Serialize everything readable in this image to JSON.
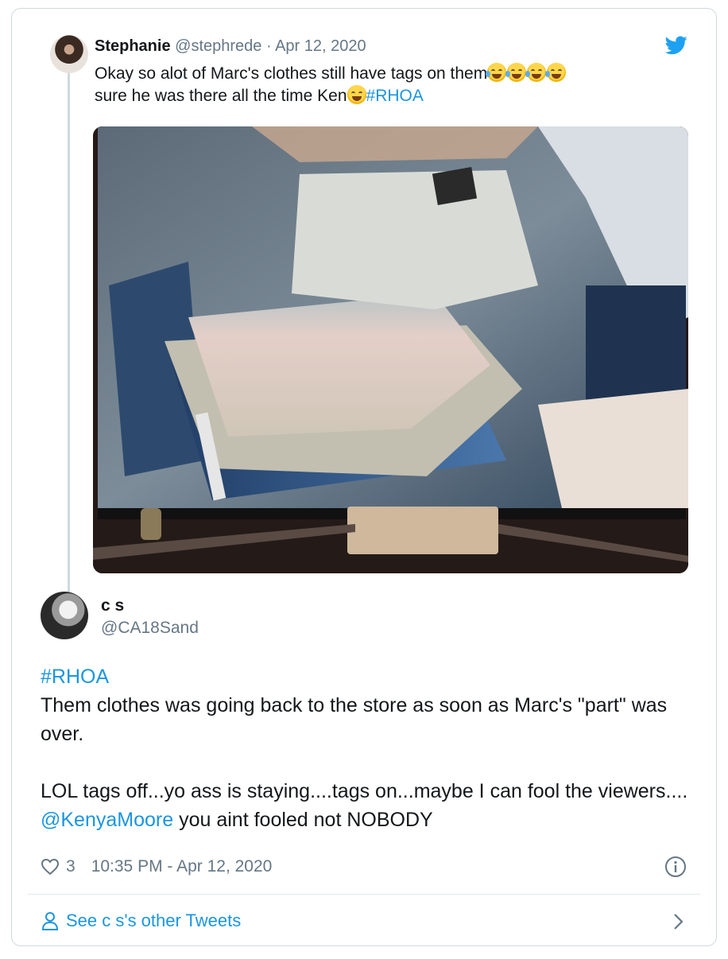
{
  "parent_tweet": {
    "name": "Stephanie",
    "handle": "@stephrede",
    "separator": " · ",
    "date": "Apr 12, 2020",
    "text_line1": "Okay  so alot of Marc's clothes still have tags on them",
    "text_line2": "sure he was there all the time Ken",
    "hashtag": "#RHOA",
    "media_alt_icon": "photo-of-folded-clothes"
  },
  "main_tweet": {
    "name": "c s",
    "handle": "@CA18Sand",
    "hashtag": "#RHOA",
    "para1": "Them clothes was going back to the store as soon as Marc's \"part\" was over.",
    "para2_start": "LOL tags off...yo ass is staying....tags on...maybe I can fool the viewers.... ",
    "mention": "@KenyaMoore",
    "para2_end": " you aint fooled not NOBODY",
    "likes": "3",
    "timestamp": "10:35 PM - Apr 12, 2020"
  },
  "footer": {
    "see_more": "See c s's other Tweets"
  },
  "colors": {
    "link": "#1b95e0",
    "muted": "#657786",
    "text": "#14171a",
    "border": "#cfd9de"
  }
}
